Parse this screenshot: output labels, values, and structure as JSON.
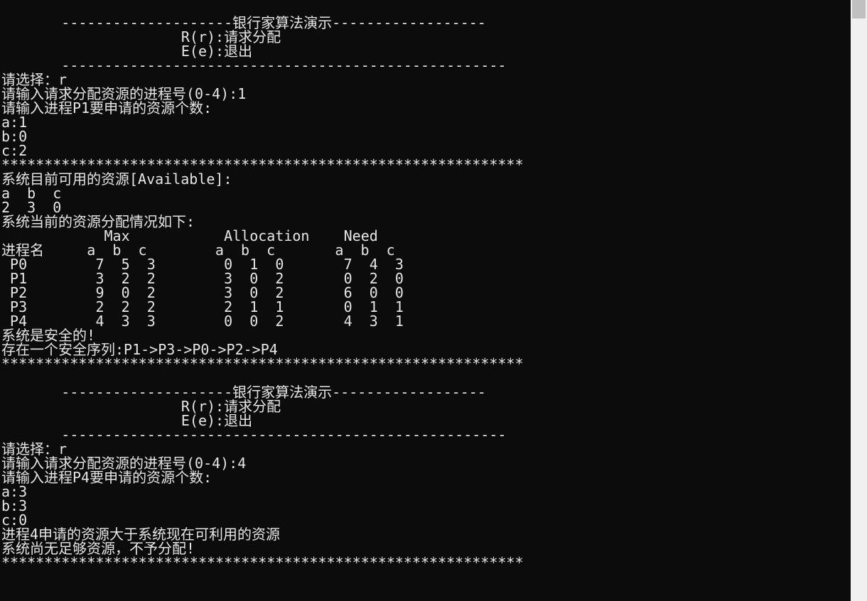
{
  "menu1": {
    "top": "       --------------------银行家算法演示------------------",
    "r": "                     R(r):请求分配",
    "e": "                     E(e):退出",
    "bottom": "       ----------------------------------------------------"
  },
  "run1": {
    "choose": "请选择：r",
    "pid": "请输入请求分配资源的进程号(0-4):1",
    "ask": "请输入进程P1要申请的资源个数:",
    "a": "a:1",
    "b": "b:0",
    "c": "c:2",
    "stars": "*************************************************************",
    "availTitle": "系统目前可用的资源[Available]:",
    "availHead": "a  b  c",
    "availVals": "2  3  0",
    "allocTitle": "系统当前的资源分配情况如下:",
    "tblHead1": "            Max           Allocation    Need",
    "tblHead2": "进程名     a  b  c        a  b  c       a  b  c",
    "p0": " P0        7  5  3        0  1  0       7  4  3",
    "p1": " P1        3  2  2        3  0  2       0  2  0",
    "p2": " P2        9  0  2        3  0  2       6  0  0",
    "p3": " P3        2  2  2        2  1  1       0  1  1",
    "p4": " P4        4  3  3        0  0  2       4  3  1",
    "safe": "系统是安全的!",
    "seq": "存在一个安全序列:P1->P3->P0->P2->P4",
    "stars2": "*************************************************************"
  },
  "menu2": {
    "top": "       --------------------银行家算法演示------------------",
    "r": "                     R(r):请求分配",
    "e": "                     E(e):退出",
    "bottom": "       ----------------------------------------------------"
  },
  "run2": {
    "choose": "请选择：r",
    "pid": "请输入请求分配资源的进程号(0-4):4",
    "ask": "请输入进程P4要申请的资源个数:",
    "a": "a:3",
    "b": "b:3",
    "c": "c:0",
    "err1": "进程4申请的资源大于系统现在可利用的资源",
    "err2": "系统尚无足够资源，不予分配!",
    "stars": "*************************************************************"
  }
}
